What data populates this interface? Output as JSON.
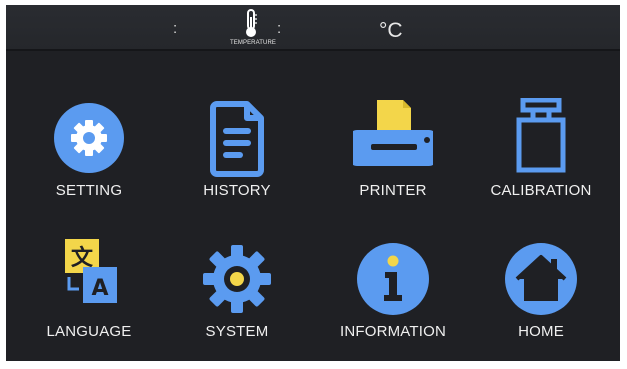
{
  "status_bar": {
    "separator_left": ":",
    "separator_right": ":",
    "temperature_label": "TEMPERATURE",
    "temperature_icon": "thermometer-icon",
    "unit": "°C"
  },
  "menu": {
    "items": [
      {
        "label": "SETTING",
        "icon": "gear-circle-icon"
      },
      {
        "label": "HISTORY",
        "icon": "document-icon"
      },
      {
        "label": "PRINTER",
        "icon": "printer-icon"
      },
      {
        "label": "CALIBRATION",
        "icon": "calibration-weight-icon"
      },
      {
        "label": "LANGUAGE",
        "icon": "translate-icon"
      },
      {
        "label": "SYSTEM",
        "icon": "cog-icon"
      },
      {
        "label": "INFORMATION",
        "icon": "info-icon"
      },
      {
        "label": "HOME",
        "icon": "home-icon"
      }
    ]
  },
  "colors": {
    "background": "#1f2024",
    "accent_blue": "#5b9bf0",
    "accent_yellow": "#f3d64a",
    "text": "#f0f0f0"
  }
}
